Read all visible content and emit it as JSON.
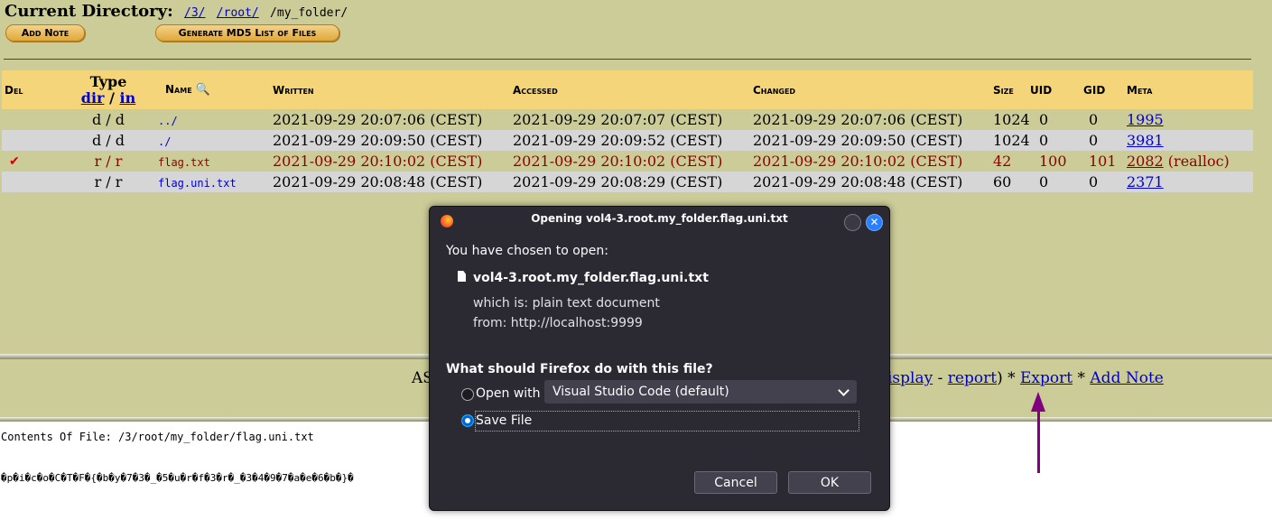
{
  "header": {
    "label": "Current Directory:",
    "path": [
      "/3/",
      "/root/",
      "/my_folder/"
    ]
  },
  "buttons": {
    "add_note": "Add Note",
    "md5": "Generate MD5 List of Files"
  },
  "table": {
    "columns": {
      "del": "Del",
      "type": "Type",
      "type_dir": "dir",
      "type_sep": "/",
      "type_in": "in",
      "name": "Name",
      "written": "Written",
      "accessed": "Accessed",
      "changed": "Changed",
      "size": "Size",
      "uid": "UID",
      "gid": "GID",
      "meta": "Meta"
    },
    "rows": [
      {
        "del": "",
        "type": "d / d",
        "name": "../",
        "written": "2021-09-29 20:07:06  (CEST)",
        "accessed": "2021-09-29 20:07:07  (CEST)",
        "changed": "2021-09-29 20:07:06  (CEST)",
        "size": "1024",
        "uid": "0",
        "gid": "0",
        "meta": "1995",
        "meta_extra": ""
      },
      {
        "del": "",
        "type": "d / d",
        "name": "./",
        "written": "2021-09-29 20:09:50  (CEST)",
        "accessed": "2021-09-29 20:09:52  (CEST)",
        "changed": "2021-09-29 20:09:50  (CEST)",
        "size": "1024",
        "uid": "0",
        "gid": "0",
        "meta": "3981",
        "meta_extra": ""
      },
      {
        "del": "✔",
        "type": "r / r",
        "name": "flag.txt",
        "written": "2021-09-29 20:10:02  (CEST)",
        "accessed": "2021-09-29 20:10:02  (CEST)",
        "changed": "2021-09-29 20:10:02  (CEST)",
        "size": "42",
        "uid": "100",
        "gid": "101",
        "meta": "2082",
        "meta_extra": " (realloc)"
      },
      {
        "del": "",
        "type": "r / r",
        "name": "flag.uni.txt",
        "written": "2021-09-29 20:08:48  (CEST)",
        "accessed": "2021-09-29 20:08:29  (CEST)",
        "changed": "2021-09-29 20:08:48  (CEST)",
        "size": "60",
        "uid": "0",
        "gid": "0",
        "meta": "2371",
        "meta_extra": ""
      }
    ]
  },
  "actions": {
    "prefix": "AS",
    "display": "isplay",
    "sep1": " - ",
    "report": "report",
    "close": ") * ",
    "export": "Export",
    "sep2": " * ",
    "add_note": "Add Note"
  },
  "contents": {
    "label": "Contents Of File: /3/root/my_folder/flag.uni.txt",
    "text": "�p�i�c�o�C�T�F�{�b�y�7�3�_�5�u�r�f�3�r�_�3�4�9�7�a�e�6�b�}�"
  },
  "dialog": {
    "title": "Opening vol4-3.root.my_folder.flag.uni.txt",
    "chosen": "You have chosen to open:",
    "filename": "vol4-3.root.my_folder.flag.uni.txt",
    "which_is_label": "which is:",
    "which_is": "plain text document",
    "from_label": "from:",
    "from": "http://localhost:9999",
    "question": "What should Firefox do with this file?",
    "open_with_label": "Open with",
    "open_with_app": "Visual Studio Code (default)",
    "save_file": "Save File",
    "selected": "save_file",
    "cancel": "Cancel",
    "ok": "OK",
    "accent": "#0061e0"
  },
  "annotation_color": "#800080"
}
